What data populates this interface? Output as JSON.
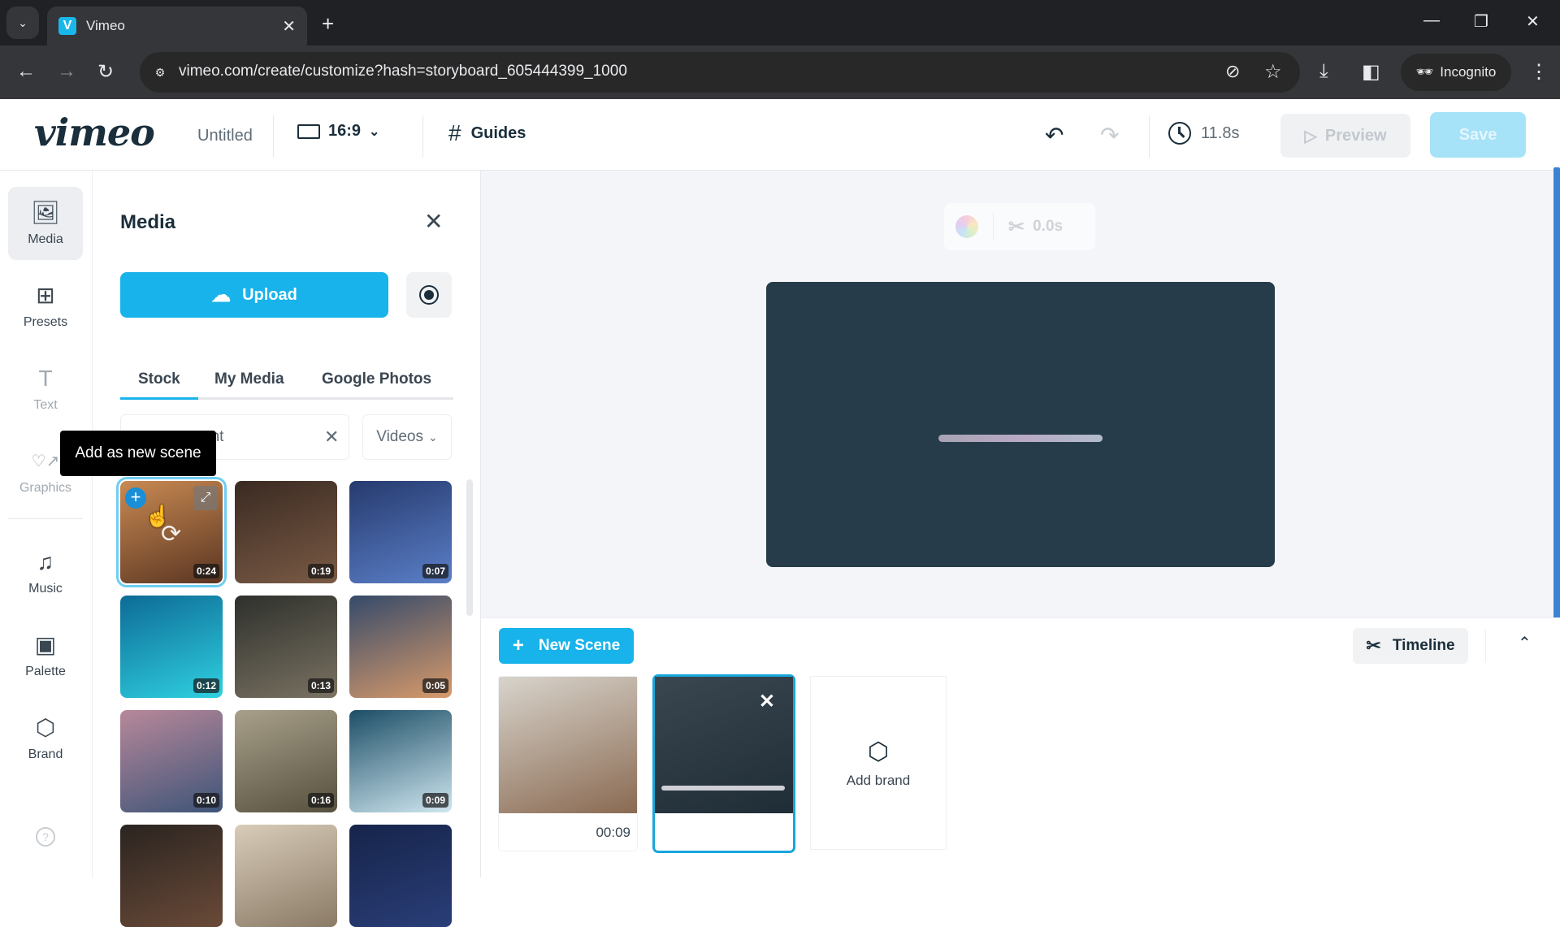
{
  "browser": {
    "tab_title": "Vimeo",
    "tab_favicon": "V",
    "url": "vimeo.com/create/customize?hash=storyboard_605444399_1000",
    "profile_label": "Incognito",
    "icons": [
      "tab-search-icon",
      "close-tab-icon",
      "new-tab-icon",
      "minimize-icon",
      "restore-icon",
      "close-window-icon",
      "back-icon",
      "forward-icon",
      "reload-icon",
      "site-info-icon",
      "eye-off-icon",
      "star-icon",
      "download-icon",
      "side-panel-icon",
      "incognito-icon",
      "menu-icon"
    ]
  },
  "header": {
    "logo": "vimeo",
    "doc_title": "Untitled",
    "aspect_ratio": "16:9",
    "guides_label": "Guides",
    "duration": "11.8s",
    "preview_label": "Preview",
    "save_label": "Save"
  },
  "rail": {
    "items": [
      {
        "label": "Media",
        "icon": "image-icon",
        "active": true
      },
      {
        "label": "Presets",
        "icon": "grid-icon"
      },
      {
        "label": "Text",
        "icon": "text-icon"
      },
      {
        "label": "Graphics",
        "icon": "shapes-icon"
      },
      {
        "label": "Music",
        "icon": "music-icon"
      },
      {
        "label": "Palette",
        "icon": "palette-icon"
      },
      {
        "label": "Brand",
        "icon": "brand-icon"
      }
    ],
    "help_icon": "?"
  },
  "media_panel": {
    "title": "Media",
    "upload_label": "Upload",
    "tabs": [
      {
        "label": "Stock",
        "active": true
      },
      {
        "label": "My Media"
      },
      {
        "label": "Google Photos"
      }
    ],
    "search_value": "ent",
    "type_filter": "Videos",
    "tooltip": "Add as new scene",
    "thumbnails": [
      {
        "duration": "0:24",
        "colors": [
          "#c98a52",
          "#5a3522"
        ],
        "selected": true
      },
      {
        "duration": "0:19",
        "colors": [
          "#3a2a22",
          "#7a5a45"
        ]
      },
      {
        "duration": "0:07",
        "colors": [
          "#263a6e",
          "#5b7fc8"
        ]
      },
      {
        "duration": "0:12",
        "colors": [
          "#0d6b96",
          "#2fd0e0"
        ]
      },
      {
        "duration": "0:13",
        "colors": [
          "#2e302c",
          "#7a7262"
        ]
      },
      {
        "duration": "0:05",
        "colors": [
          "#354a6a",
          "#d89a6a"
        ]
      },
      {
        "duration": "0:10",
        "colors": [
          "#b8889a",
          "#3e5478"
        ]
      },
      {
        "duration": "0:16",
        "colors": [
          "#a8a08a",
          "#56503e"
        ]
      },
      {
        "duration": "0:09",
        "colors": [
          "#1c4e66",
          "#cfe6f0"
        ]
      },
      {
        "duration": "",
        "colors": [
          "#2a2420",
          "#6a4a38"
        ]
      },
      {
        "duration": "",
        "colors": [
          "#d8ccb8",
          "#8a7a66"
        ]
      },
      {
        "duration": "",
        "colors": [
          "#16244a",
          "#2a3e78"
        ]
      }
    ]
  },
  "canvas": {
    "trim_label": "0.0s",
    "background": "#263c4a"
  },
  "scenes": {
    "new_scene_label": "New Scene",
    "timeline_label": "Timeline",
    "items": [
      {
        "time": "00:09",
        "colors": [
          "#d8d4cc",
          "#8a6a52"
        ]
      },
      {
        "time": "",
        "active": true,
        "colors": [
          "#3a4650",
          "#1f2d36"
        ]
      }
    ],
    "add_brand_label": "Add brand"
  },
  "colors": {
    "accent": "#17b3ea",
    "canvas": "#263c4a",
    "text_dark": "#1a2e3b"
  }
}
